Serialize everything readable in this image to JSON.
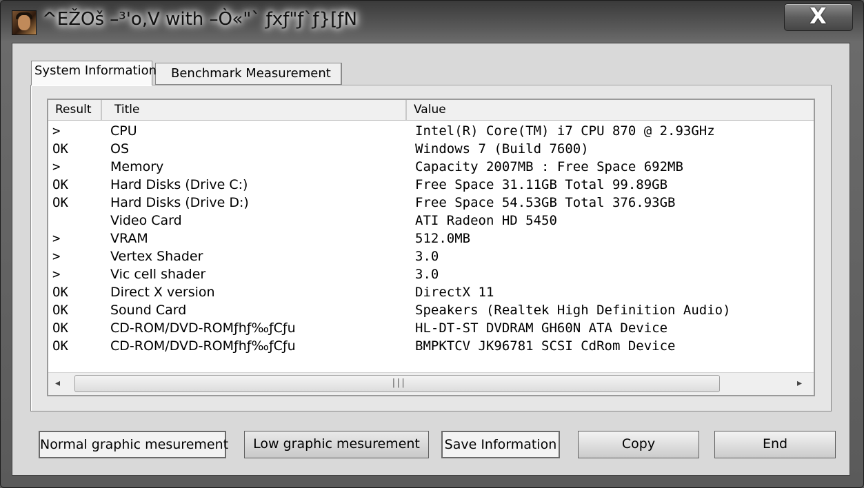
{
  "window": {
    "title": "^EŽOš –³'o‚V with –Ò«\"` ƒxƒ\"ƒ`ƒ}[ƒN",
    "close_label": "X"
  },
  "tabs": [
    {
      "label": "System Information",
      "active": true
    },
    {
      "label": "Benchmark Measurement",
      "active": false
    }
  ],
  "table": {
    "headers": [
      "Result",
      "Title",
      "Value"
    ],
    "rows": [
      {
        "result": ">",
        "title": "CPU",
        "value": "Intel(R) Core(TM) i7 CPU        870  @ 2.93GHz"
      },
      {
        "result": "OK",
        "title": "OS",
        "value": "Windows 7 (Build 7600)"
      },
      {
        "result": ">",
        "title": "Memory",
        "value": "Capacity 2007MB  : Free Space 692MB"
      },
      {
        "result": "OK",
        "title": "Hard Disks (Drive C:)",
        "value": "Free Space 31.11GB   Total  99.89GB"
      },
      {
        "result": "OK",
        "title": "Hard Disks (Drive D:)",
        "value": "Free Space 54.53GB   Total  376.93GB"
      },
      {
        "result": "",
        "title": "Video Card",
        "value": "ATI Radeon HD 5450"
      },
      {
        "result": ">",
        "title": "VRAM",
        "value": "512.0MB"
      },
      {
        "result": ">",
        "title": "Vertex Shader",
        "value": "3.0"
      },
      {
        "result": ">",
        "title": "Vic cell shader",
        "value": "3.0"
      },
      {
        "result": "OK",
        "title": "Direct  X version",
        "value": "DirectX 11"
      },
      {
        "result": "OK",
        "title": "Sound Card",
        "value": "Speakers (Realtek High Definition Audio)"
      },
      {
        "result": "OK",
        "title": "CD-ROM/DVD-ROMƒhƒ‰ƒCƒu",
        "value": "HL-DT-ST DVDRAM GH60N ATA Device"
      },
      {
        "result": "OK",
        "title": "CD-ROM/DVD-ROMƒhƒ‰ƒCƒu",
        "value": "BMPKTCV JK96781 SCSI CdRom Device"
      }
    ]
  },
  "buttons": {
    "normal": "Normal graphic mesurement",
    "low": "Low graphic mesurement",
    "save": "Save Information",
    "copy": "Copy",
    "end": "End"
  },
  "scrollbar": {
    "left_arrow": "◂",
    "right_arrow": "▸",
    "grip": "|||"
  }
}
